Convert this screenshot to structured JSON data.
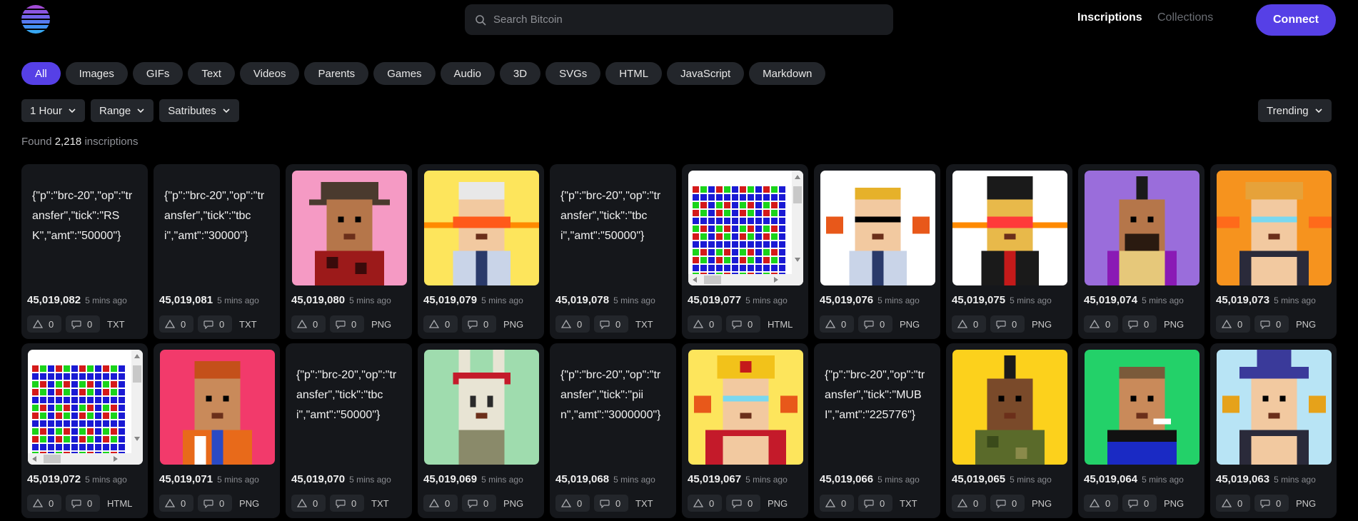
{
  "header": {
    "search_placeholder": "Search Bitcoin",
    "nav": [
      "Inscriptions",
      "Collections"
    ],
    "connect_label": "Connect"
  },
  "filters": [
    "All",
    "Images",
    "GIFs",
    "Text",
    "Videos",
    "Parents",
    "Games",
    "Audio",
    "3D",
    "SVGs",
    "HTML",
    "JavaScript",
    "Markdown"
  ],
  "active_filter": "All",
  "dropdowns": [
    "1 Hour",
    "Range",
    "Satributes"
  ],
  "sort_label": "Trending",
  "found": {
    "prefix": "Found",
    "count": "2,218",
    "suffix": "inscriptions"
  },
  "cards": [
    {
      "number": "45,019,082",
      "time": "5 mins ago",
      "likes": "0",
      "comments": "0",
      "type": "TXT",
      "preview": "text",
      "text": "{\"p\":\"brc-20\",\"op\":\"transfer\",\"tick\":\"RSK\",\"amt\":\"50000\"}"
    },
    {
      "number": "45,019,081",
      "time": "5 mins ago",
      "likes": "0",
      "comments": "0",
      "type": "TXT",
      "preview": "text",
      "text": "{\"p\":\"brc-20\",\"op\":\"transfer\",\"tick\":\"tbci\",\"amt\":\"30000\"}"
    },
    {
      "number": "45,019,080",
      "time": "5 mins ago",
      "likes": "0",
      "comments": "0",
      "type": "PNG",
      "preview": "image",
      "art": "hat-guy",
      "bg": "#f59ac4"
    },
    {
      "number": "45,019,079",
      "time": "5 mins ago",
      "likes": "0",
      "comments": "0",
      "type": "PNG",
      "preview": "image",
      "art": "laser-suit",
      "bg": "#fde55c"
    },
    {
      "number": "45,019,078",
      "time": "5 mins ago",
      "likes": "0",
      "comments": "0",
      "type": "TXT",
      "preview": "text",
      "text": "{\"p\":\"brc-20\",\"op\":\"transfer\",\"tick\":\"tbci\",\"amt\":\"50000\"}"
    },
    {
      "number": "45,019,077",
      "time": "5 mins ago",
      "likes": "0",
      "comments": "0",
      "type": "HTML",
      "preview": "html"
    },
    {
      "number": "45,019,076",
      "time": "5 mins ago",
      "likes": "0",
      "comments": "0",
      "type": "PNG",
      "preview": "image",
      "art": "hearts-suit",
      "bg": "#ffffff"
    },
    {
      "number": "45,019,075",
      "time": "5 mins ago",
      "likes": "0",
      "comments": "0",
      "type": "PNG",
      "preview": "image",
      "art": "bowler-laser",
      "bg": "#ffffff"
    },
    {
      "number": "45,019,074",
      "time": "5 mins ago",
      "likes": "0",
      "comments": "0",
      "type": "PNG",
      "preview": "image",
      "art": "mohawk",
      "bg": "#9a6ddb"
    },
    {
      "number": "45,019,073",
      "time": "5 mins ago",
      "likes": "0",
      "comments": "0",
      "type": "PNG",
      "preview": "image",
      "art": "pizza-king",
      "bg": "#f6931e"
    },
    {
      "number": "45,019,072",
      "time": "5 mins ago",
      "likes": "0",
      "comments": "0",
      "type": "HTML",
      "preview": "html"
    },
    {
      "number": "45,019,071",
      "time": "5 mins ago",
      "likes": "0",
      "comments": "0",
      "type": "PNG",
      "preview": "image",
      "art": "beanie",
      "bg": "#f23a6b"
    },
    {
      "number": "45,019,070",
      "time": "5 mins ago",
      "likes": "0",
      "comments": "0",
      "type": "TXT",
      "preview": "text",
      "text": "{\"p\":\"brc-20\",\"op\":\"transfer\",\"tick\":\"tbci\",\"amt\":\"50000\"}"
    },
    {
      "number": "45,019,069",
      "time": "5 mins ago",
      "likes": "0",
      "comments": "0",
      "type": "PNG",
      "preview": "image",
      "art": "bunny-skull",
      "bg": "#9fdcae"
    },
    {
      "number": "45,019,068",
      "time": "5 mins ago",
      "likes": "0",
      "comments": "0",
      "type": "TXT",
      "preview": "text",
      "text": "{\"p\":\"brc-20\",\"op\":\"transfer\",\"tick\":\"piin\",\"amt\":\"3000000\"}"
    },
    {
      "number": "45,019,067",
      "time": "5 mins ago",
      "likes": "0",
      "comments": "0",
      "type": "PNG",
      "preview": "image",
      "art": "crown-king",
      "bg": "#fde55c"
    },
    {
      "number": "45,019,066",
      "time": "5 mins ago",
      "likes": "0",
      "comments": "0",
      "type": "TXT",
      "preview": "text",
      "text": "{\"p\":\"brc-20\",\"op\":\"transfer\",\"tick\":\"MUBI\",\"amt\":\"225776\"}"
    },
    {
      "number": "45,019,065",
      "time": "5 mins ago",
      "likes": "0",
      "comments": "0",
      "type": "PNG",
      "preview": "image",
      "art": "camo",
      "bg": "#fcd11c"
    },
    {
      "number": "45,019,064",
      "time": "5 mins ago",
      "likes": "0",
      "comments": "0",
      "type": "PNG",
      "preview": "image",
      "art": "goggles",
      "bg": "#23d169"
    },
    {
      "number": "45,019,063",
      "time": "5 mins ago",
      "likes": "0",
      "comments": "0",
      "type": "PNG",
      "preview": "image",
      "art": "wizard",
      "bg": "#b8e4f5"
    }
  ],
  "colors": {
    "accent": "#5640e6",
    "card": "#15171b",
    "chip": "#23262b"
  }
}
